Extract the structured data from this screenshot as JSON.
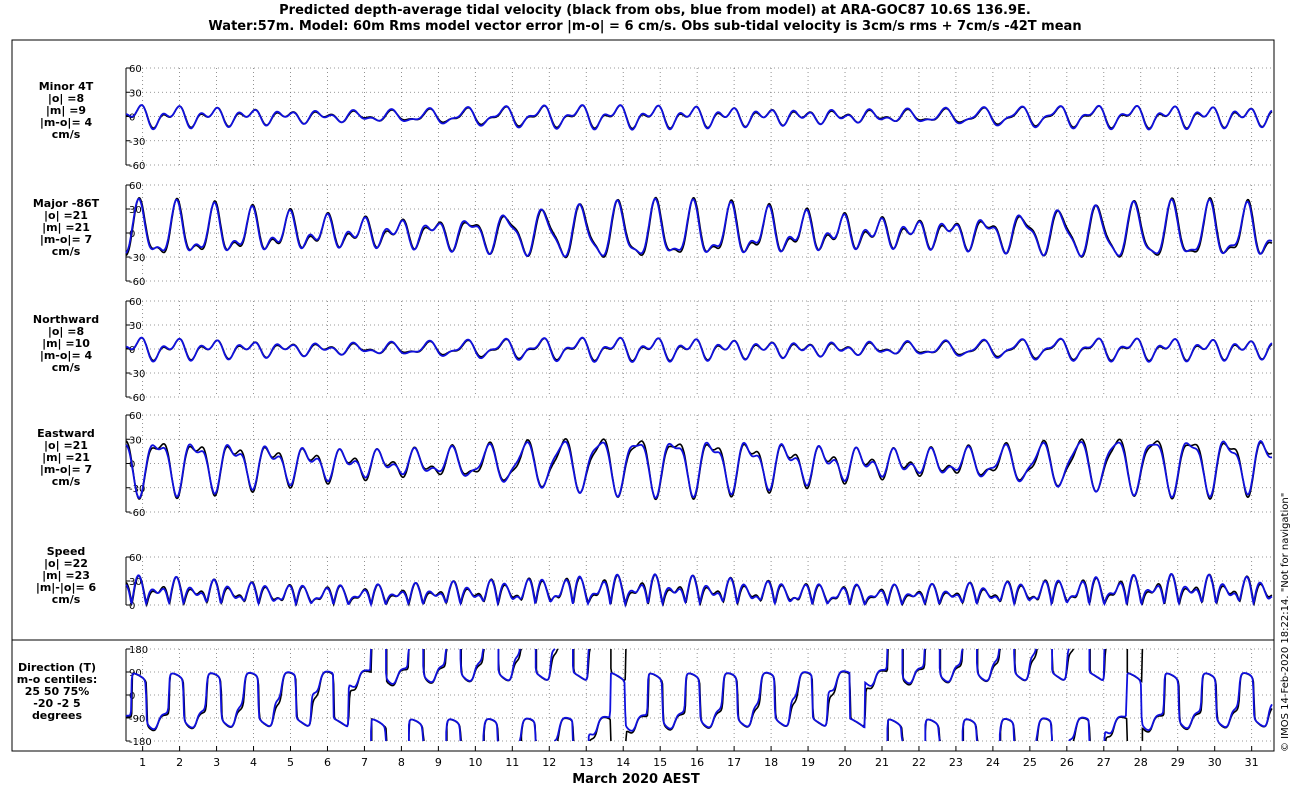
{
  "title_line1": "Predicted depth-average tidal velocity (black from obs, blue from model) at ARA-GOC87 10.6S 136.9E.",
  "title_line2": "Water:57m. Model: 60m  Rms model vector error |m-o| = 6 cm/s. Obs sub-tidal velocity is 3cm/s rms + 7cm/s -42T mean",
  "xlabel": "March 2020 AEST",
  "side_note": "© IMOS 14-Feb-2020 18:22:14.  \"Not for navigation\"",
  "colors": {
    "obs": "#000000",
    "model": "#1010dd",
    "grid": "#777777"
  },
  "chart_data": [
    {
      "type": "line",
      "name_label": "Minor 4T",
      "stats": [
        "|o| =8",
        "|m| =9",
        "|m-o|= 4",
        "cm/s"
      ],
      "ylim": [
        -60,
        60
      ],
      "yticks": [
        -60,
        -30,
        0,
        30,
        60
      ],
      "x": [
        1,
        31
      ],
      "series": [
        {
          "name": "obs"
        },
        {
          "name": "model"
        }
      ]
    },
    {
      "type": "line",
      "name_label": "Major -86T",
      "stats": [
        "|o| =21",
        "|m| =21",
        "|m-o|= 7",
        "cm/s"
      ],
      "ylim": [
        -60,
        60
      ],
      "yticks": [
        -60,
        -30,
        0,
        30,
        60
      ],
      "x": [
        1,
        31
      ],
      "series": [
        {
          "name": "obs"
        },
        {
          "name": "model"
        }
      ]
    },
    {
      "type": "line",
      "name_label": "Northward",
      "stats": [
        "|o| =8",
        "|m| =10",
        "|m-o|= 4",
        "cm/s"
      ],
      "ylim": [
        -60,
        60
      ],
      "yticks": [
        -60,
        -30,
        0,
        30,
        60
      ],
      "x": [
        1,
        31
      ],
      "series": [
        {
          "name": "obs"
        },
        {
          "name": "model"
        }
      ]
    },
    {
      "type": "line",
      "name_label": "Eastward",
      "stats": [
        "|o| =21",
        "|m| =21",
        "|m-o|= 7",
        "cm/s"
      ],
      "ylim": [
        -60,
        60
      ],
      "yticks": [
        -60,
        -30,
        0,
        30,
        60
      ],
      "x": [
        1,
        31
      ],
      "series": [
        {
          "name": "obs"
        },
        {
          "name": "model"
        }
      ]
    },
    {
      "type": "line",
      "name_label": "Speed",
      "stats": [
        "|o| =22",
        "|m| =23",
        "|m|-|o|= 6",
        "cm/s"
      ],
      "ylim": [
        0,
        60
      ],
      "yticks": [
        0,
        30,
        60
      ],
      "x": [
        1,
        31
      ],
      "series": [
        {
          "name": "obs"
        },
        {
          "name": "model"
        }
      ]
    },
    {
      "type": "line",
      "name_label": "Direction (T)",
      "stats": [
        "m-o centiles:",
        "25  50  75%",
        "-20  -2   5",
        "degrees"
      ],
      "ylim": [
        -180,
        180
      ],
      "yticks": [
        -180,
        -90,
        0,
        90,
        180
      ],
      "x": [
        1,
        31
      ],
      "series": [
        {
          "name": "obs"
        },
        {
          "name": "model"
        }
      ]
    }
  ],
  "x_tick_labels": [
    "1",
    "2",
    "3",
    "4",
    "5",
    "6",
    "7",
    "8",
    "9",
    "10",
    "11",
    "12",
    "13",
    "14",
    "15",
    "16",
    "17",
    "18",
    "19",
    "20",
    "21",
    "22",
    "23",
    "24",
    "25",
    "26",
    "27",
    "28",
    "29",
    "30",
    "31"
  ]
}
